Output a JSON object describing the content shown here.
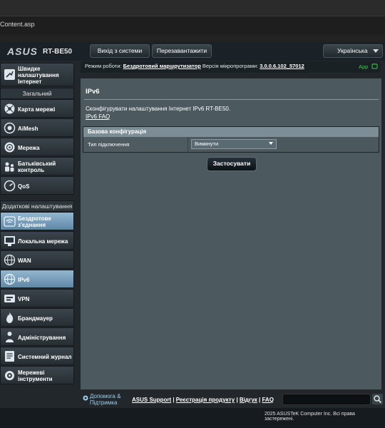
{
  "browser": {
    "address": "Content.asp"
  },
  "header": {
    "logo": "ASUS",
    "model": "RT-BE50",
    "logout_label": "Вихід з системи",
    "reboot_label": "Перезавантажити",
    "language": "Українська"
  },
  "status": {
    "mode_label": "Режим роботи:",
    "mode_value": "Бездротовий маршрутизатор",
    "fw_label": "Версія мікропрограми:",
    "fw_value": "3.0.0.6.102_57012",
    "app_label": "App"
  },
  "sidebar": {
    "quick_setup": "Швидке налаштування Інтернет",
    "general_header": "Загальний",
    "general_items": [
      {
        "label": "Карта мережі",
        "icon": "network-map-icon"
      },
      {
        "label": "AiMesh",
        "icon": "aimesh-icon"
      },
      {
        "label": "Мережа",
        "icon": "network-icon"
      },
      {
        "label": "Батьківський контроль",
        "icon": "parental-control-icon"
      },
      {
        "label": "QoS",
        "icon": "qos-icon"
      }
    ],
    "advanced_header": "Додаткові налаштування",
    "advanced_items": [
      {
        "label": "Бездротове з'єднання",
        "icon": "wireless-icon"
      },
      {
        "label": "Локальна мережа",
        "icon": "lan-icon"
      },
      {
        "label": "WAN",
        "icon": "wan-icon"
      },
      {
        "label": "IPv6",
        "icon": "ipv6-icon",
        "active": true
      },
      {
        "label": "VPN",
        "icon": "vpn-icon"
      },
      {
        "label": "Брандмауер",
        "icon": "firewall-icon"
      },
      {
        "label": "Адміністрування",
        "icon": "administration-icon"
      },
      {
        "label": "Системний журнал",
        "icon": "system-log-icon"
      },
      {
        "label": "Мережеві інструменти",
        "icon": "network-tools-icon"
      }
    ]
  },
  "content": {
    "title": "IPv6",
    "description": "Сконфігурувати налаштування Інтернет IPv6 RT-BE50.",
    "faq_link": "IPv6 FAQ",
    "table_header": "Базова конфігурація",
    "field_label": "Тип підключення",
    "field_value": "Вимкнути",
    "apply_label": "Застосувати"
  },
  "footer": {
    "help": "Допомога & Підтримка",
    "links": [
      "ASUS Support",
      "Реєстрація продукту",
      "Відгук",
      "FAQ"
    ],
    "copyright": "2025 ASUSTeK Computer Inc. Всі права застережені."
  },
  "colors": {
    "accent_active": "#7fa6c4",
    "app_green": "#2dd43b",
    "content_panel": "#4c5a60"
  }
}
